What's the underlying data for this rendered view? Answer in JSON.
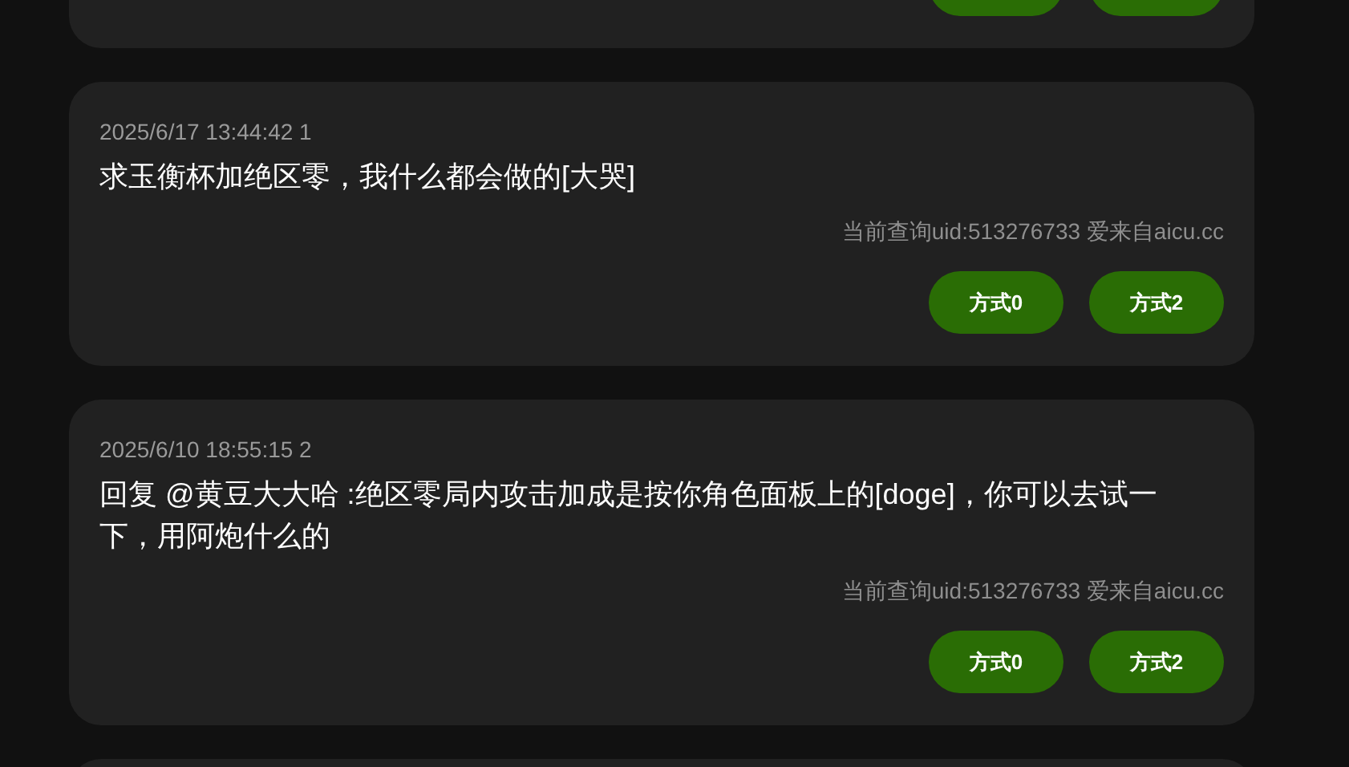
{
  "comments": [
    {
      "kind": "tail",
      "buttons": [
        {
          "kind": "pill"
        },
        {
          "kind": "pill"
        }
      ]
    },
    {
      "kind": "full",
      "meta": "2025/6/17 13:44:42 1",
      "text": "求玉衡杯加绝区零，我什么都会做的[大哭]",
      "source": "当前查询uid:513276733 爱来自aicu.cc",
      "buttons": [
        {
          "kind": "pill",
          "label": "方式0"
        },
        {
          "kind": "pill",
          "label": "方式2"
        }
      ]
    },
    {
      "kind": "full",
      "meta": "2025/6/10 18:55:15 2",
      "text": "回复 @黄豆大大哈 :绝区零局内攻击加成是按你角色面板上的[doge]，你可以去试一下，用阿炮什么的",
      "source": "当前查询uid:513276733 爱来自aicu.cc",
      "buttons": [
        {
          "kind": "pill",
          "label": "方式0"
        },
        {
          "kind": "pill",
          "label": "方式2"
        }
      ]
    },
    {
      "kind": "head"
    }
  ]
}
